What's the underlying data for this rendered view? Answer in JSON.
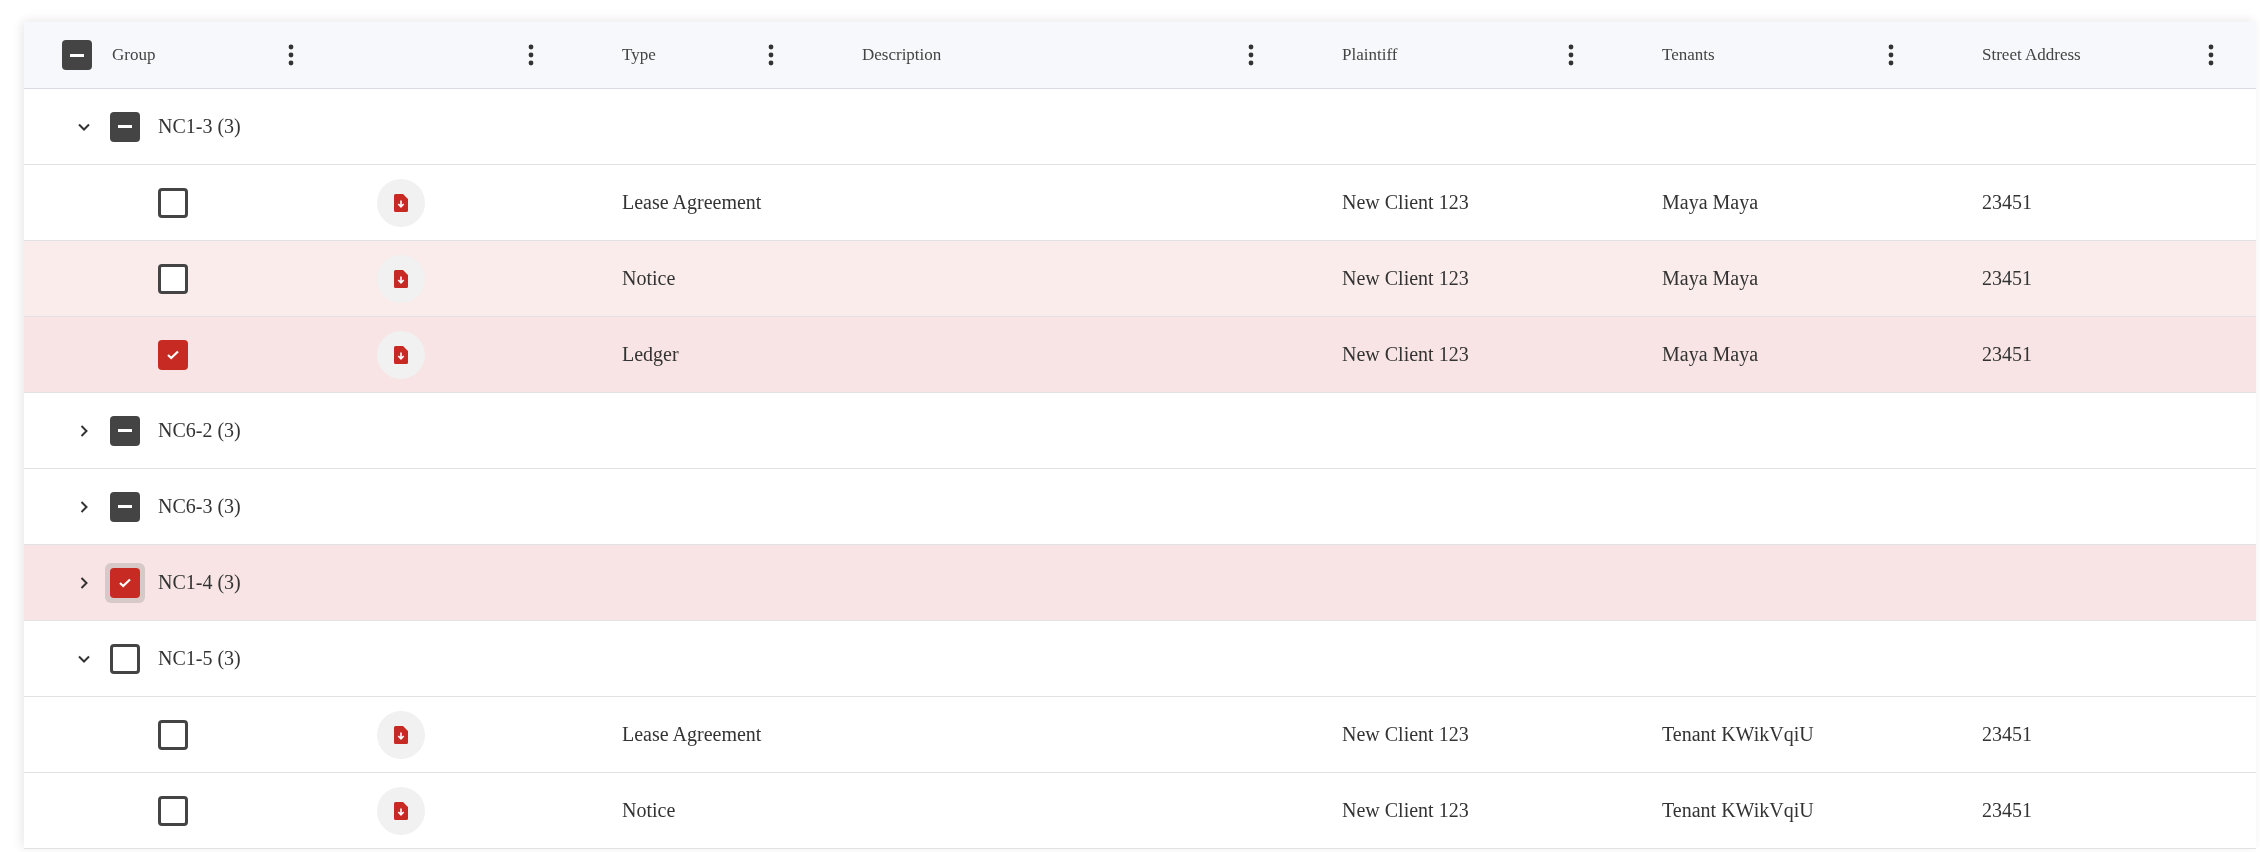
{
  "table": {
    "header_checked": false,
    "header_indeterminate": true,
    "columns": [
      {
        "kind": "group",
        "label": "Group"
      },
      {
        "kind": "icon"
      },
      {
        "kind": "text",
        "label": "Type"
      },
      {
        "kind": "text",
        "label": "Description"
      },
      {
        "kind": "text",
        "label": "Plaintiff"
      },
      {
        "kind": "text",
        "label": "Tenants"
      },
      {
        "kind": "text",
        "label": "Street Address"
      }
    ],
    "groups": [
      {
        "label": "NC1-3 (3)",
        "expanded": true,
        "checked": false,
        "indeterminate": true,
        "selected": false,
        "focused": false,
        "rows": [
          {
            "type": "Lease Agreement",
            "plaintiff": "New Client 123",
            "tenants": "Maya Maya",
            "street_address": "23451",
            "checked": false,
            "hovered": false
          },
          {
            "type": "Notice",
            "plaintiff": "New Client 123",
            "tenants": "Maya Maya",
            "street_address": "23451",
            "checked": false,
            "hovered": true
          },
          {
            "type": "Ledger",
            "plaintiff": "New Client 123",
            "tenants": "Maya Maya",
            "street_address": "23451",
            "checked": true,
            "hovered": false
          }
        ]
      },
      {
        "label": "NC6-2 (3)",
        "expanded": false,
        "checked": false,
        "indeterminate": true,
        "selected": false,
        "focused": false
      },
      {
        "label": "NC6-3 (3)",
        "expanded": false,
        "checked": false,
        "indeterminate": true,
        "selected": false,
        "focused": false
      },
      {
        "label": "NC1-4 (3)",
        "expanded": false,
        "checked": true,
        "indeterminate": false,
        "selected": true,
        "focused": true
      },
      {
        "label": "NC1-5 (3)",
        "expanded": true,
        "checked": false,
        "indeterminate": false,
        "selected": false,
        "focused": false,
        "rows": [
          {
            "type": "Lease Agreement",
            "plaintiff": "New Client 123",
            "tenants": "Tenant KWikVqiU",
            "street_address": "23451",
            "checked": false,
            "hovered": false
          },
          {
            "type": "Notice",
            "plaintiff": "New Client 123",
            "tenants": "Tenant KWikVqiU",
            "street_address": "23451",
            "checked": false,
            "hovered": false
          }
        ]
      }
    ]
  }
}
